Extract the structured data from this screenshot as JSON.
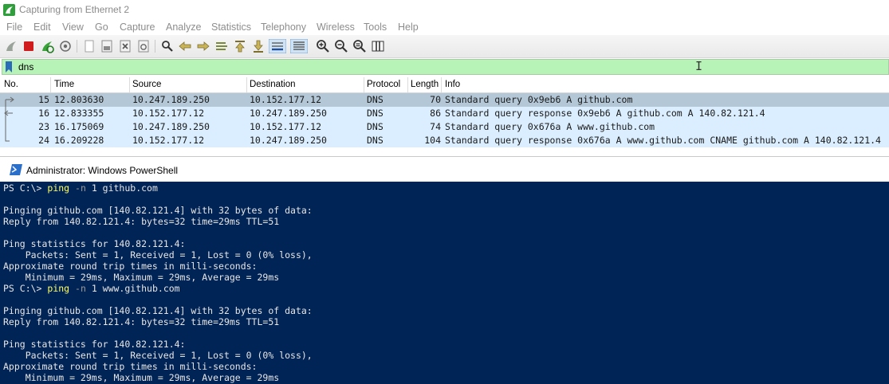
{
  "wireshark": {
    "title": "Capturing from Ethernet 2",
    "menu": [
      "File",
      "Edit",
      "View",
      "Go",
      "Capture",
      "Analyze",
      "Statistics",
      "Telephony",
      "Wireless",
      "Tools",
      "Help"
    ],
    "filter": {
      "value": "dns"
    },
    "columns": [
      "No.",
      "Time",
      "Source",
      "Destination",
      "Protocol",
      "Length",
      "Info"
    ],
    "packets": [
      {
        "no": "15",
        "time": "12.803630",
        "source": "10.247.189.250",
        "destination": "10.152.177.12",
        "protocol": "DNS",
        "length": "70",
        "info": "Standard query 0x9eb6 A github.com"
      },
      {
        "no": "16",
        "time": "12.833355",
        "source": "10.152.177.12",
        "destination": "10.247.189.250",
        "protocol": "DNS",
        "length": "86",
        "info": "Standard query response 0x9eb6 A github.com A 140.82.121.4"
      },
      {
        "no": "23",
        "time": "16.175069",
        "source": "10.247.189.250",
        "destination": "10.152.177.12",
        "protocol": "DNS",
        "length": "74",
        "info": "Standard query 0x676a A www.github.com"
      },
      {
        "no": "24",
        "time": "16.209228",
        "source": "10.152.177.12",
        "destination": "10.247.189.250",
        "protocol": "DNS",
        "length": "104",
        "info": "Standard query response 0x676a A www.github.com CNAME github.com A 140.82.121.4"
      }
    ],
    "colors": {
      "selected_row": "#b3c7d6",
      "dns_row": "#daeeff",
      "filter_ok": "#b7f2b7"
    }
  },
  "powershell": {
    "title": "Administrator: Windows PowerShell",
    "session1": {
      "prompt": "PS C:\\> ",
      "cmd": "ping",
      "flag": "-n",
      "args": " 1 github.com",
      "lines": [
        "",
        "Pinging github.com [140.82.121.4] with 32 bytes of data:",
        "Reply from 140.82.121.4: bytes=32 time=29ms TTL=51",
        "",
        "Ping statistics for 140.82.121.4:",
        "    Packets: Sent = 1, Received = 1, Lost = 0 (0% loss),",
        "Approximate round trip times in milli-seconds:",
        "    Minimum = 29ms, Maximum = 29ms, Average = 29ms"
      ]
    },
    "session2": {
      "prompt": "PS C:\\> ",
      "cmd": "ping",
      "flag": "-n",
      "args": " 1 www.github.com",
      "lines": [
        "",
        "Pinging github.com [140.82.121.4] with 32 bytes of data:",
        "Reply from 140.82.121.4: bytes=32 time=29ms TTL=51",
        "",
        "Ping statistics for 140.82.121.4:",
        "    Packets: Sent = 1, Received = 1, Lost = 0 (0% loss),",
        "Approximate round trip times in milli-seconds:",
        "    Minimum = 29ms, Maximum = 29ms, Average = 29ms"
      ]
    },
    "colors": {
      "background": "#012456",
      "command": "#ffff66",
      "parameter": "#9a9a9a"
    }
  }
}
